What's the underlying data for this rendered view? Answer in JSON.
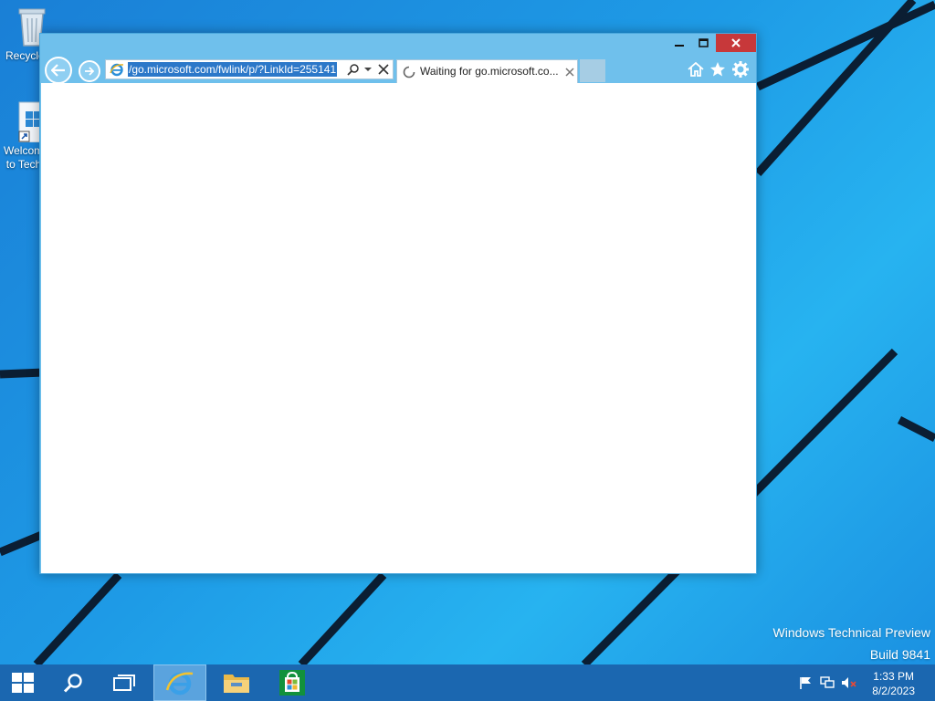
{
  "desktop": {
    "icons": [
      {
        "label": "Recycle Bin"
      },
      {
        "label": "Welcome to Tech Preview"
      }
    ],
    "watermark": {
      "line1": "Windows Technical Preview",
      "line2": "Build 9841"
    }
  },
  "browser": {
    "address_value": "/go.microsoft.com/fwlink/p/?LinkId=255141",
    "tab_title": "Waiting for go.microsoft.co..."
  },
  "taskbar": {
    "time": "1:33 PM",
    "date": "8/2/2023"
  },
  "colors": {
    "window_frame": "#6fc0ec",
    "close_button": "#c7383a",
    "taskbar": "#1b67b0",
    "address_selection": "#2c78c9"
  }
}
